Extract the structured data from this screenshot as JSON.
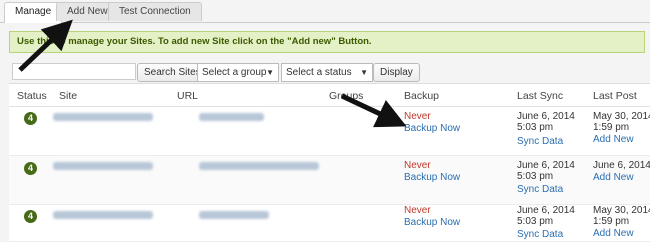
{
  "tabs": [
    "Manage",
    "Add New",
    "Test Connection"
  ],
  "notice": "Use this to manage your Sites. To add new Site click on the \"Add new\" Button.",
  "filters": {
    "search_button": "Search Sites",
    "group_select": "Select a group",
    "status_select": "Select a status",
    "display_button": "Display"
  },
  "columns": [
    "Status",
    "Site",
    "URL",
    "Groups",
    "Backup",
    "Last Sync",
    "Last Post"
  ],
  "rows": [
    {
      "status": "4",
      "backup_state": "Never",
      "backup_action": "Backup Now",
      "last_sync": "June 6, 2014 5:03 pm",
      "sync_action": "Sync Data",
      "last_post": "May 30, 2014 1:59 pm",
      "post_action": "Add New"
    },
    {
      "status": "4",
      "backup_state": "Never",
      "backup_action": "Backup Now",
      "last_sync": "June 6, 2014 5:03 pm",
      "sync_action": "Sync Data",
      "last_post": "June 6, 2014 4:0",
      "post_action": "Add New"
    },
    {
      "status": "4",
      "backup_state": "Never",
      "backup_action": "Backup Now",
      "last_sync": "June 6, 2014 5:03 pm",
      "sync_action": "Sync Data",
      "last_post": "May 30, 2014 1:59 pm",
      "post_action": "Add New"
    }
  ],
  "colors": {
    "accent_green": "#456a18",
    "notice_bg": "#e4f0c6",
    "link_blue": "#2a6fb0",
    "never_red": "#c0392b"
  }
}
